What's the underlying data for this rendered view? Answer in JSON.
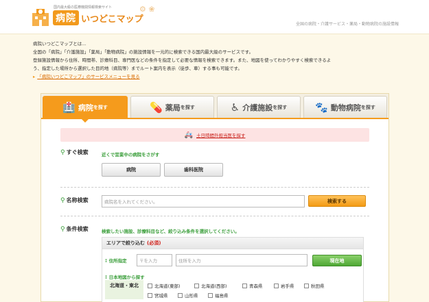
{
  "header": {
    "logo_sub": "国内最大級の医療機関情報検索サイト",
    "logo_byoin": "病院",
    "logo_rest": "いつどこマップ",
    "logo_deco": "⚙ ❀",
    "right_text": "全国の病院・介護サービス・薬局・動物病院の施設情報"
  },
  "intro": {
    "line1": "病院いつどこマップとは…",
    "line2": "全国の「病院」「介護施設」「薬局」「動物病院」の施設情報を一元的に検索できる国内最大級のサービスです。",
    "line3": "登録施設情報から住所、時間帯、診療科目、専門医などの条件を指定して必要な情報を検索できます。また、地図を使ってわかりやすく検索できるよ",
    "line4": "う、指定した場所から選択した目的地（病院等）までルート案内を表示（徒歩、車）する事も可能です。",
    "link": "「病院いつどこマップ」のサービスメニューを見る"
  },
  "tabs": [
    {
      "icon": "🏥",
      "big": "病院",
      "small": "を探す",
      "state": "active"
    },
    {
      "icon": "💊",
      "big": "薬局",
      "small": "を探す",
      "state": "inactive"
    },
    {
      "icon": "♿",
      "big": "介護施設",
      "small": "を探す",
      "state": "inactive"
    },
    {
      "icon": "🐾",
      "big": "動物病院",
      "small": "を探す",
      "state": "inactive"
    }
  ],
  "banner": {
    "icon": "🚑",
    "text": "土日時間外担当医を探す"
  },
  "quick": {
    "label": "すぐ検索",
    "desc": "近くで営業中の病院をさがす",
    "btn_hospital": "病院",
    "btn_dental": "歯科医院"
  },
  "name_search": {
    "label": "名称検索",
    "placeholder": "病院名を入れてください。",
    "button": "検索する"
  },
  "cond": {
    "label": "条件検索",
    "desc": "検索したい施設、診療科目など、絞り込み条件を選択してください。"
  },
  "area": {
    "head": "エリアで絞り込む",
    "required": "(必須)",
    "addr_label": "住所指定",
    "zip_placeholder": "〒を入力",
    "addr_placeholder": "住所を入力",
    "current_btn": "現在地",
    "map_label": "日本地図から探す",
    "region": "北海道・東北",
    "prefs": [
      "北海道(東部)",
      "北海道(西部)",
      "青森県",
      "岩手県",
      "秋田県",
      "宮城県",
      "山形県",
      "福島県"
    ]
  },
  "icons": {
    "search": "search-icon",
    "triangle": "triangle-right-icon"
  }
}
